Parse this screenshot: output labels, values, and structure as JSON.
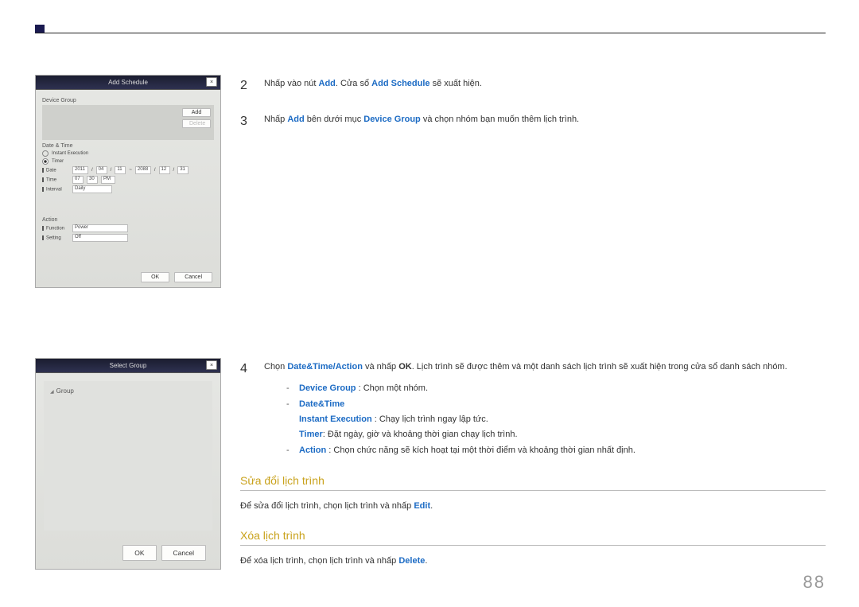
{
  "page_number": "88",
  "screenshots": {
    "add_schedule": {
      "title": "Add Schedule",
      "close": "×",
      "device_group_label": "Device Group",
      "add_btn": "Add",
      "delete_btn": "Delete",
      "datetime_label": "Date & Time",
      "instant_radio": "Instant Execution",
      "timer_radio": "Timer",
      "date_label": "Date",
      "date_y1": "2011",
      "date_m1": "04",
      "date_d1": "11",
      "date_tilde": "~",
      "date_y2": "2088",
      "date_m2": "12",
      "date_d2": "31",
      "time_label": "Time",
      "time_h": "07",
      "time_m": "30",
      "time_ampm": "PM",
      "interval_label": "Interval",
      "interval_val": "Daily",
      "action_label": "Action",
      "function_label": "Function",
      "function_val": "Power",
      "setting_label": "Setting",
      "setting_val": "Off",
      "ok": "OK",
      "cancel": "Cancel"
    },
    "select_group": {
      "title": "Select Group",
      "close": "×",
      "tree_root": "Group",
      "ok": "OK",
      "cancel": "Cancel"
    }
  },
  "steps": {
    "s2": {
      "num": "2",
      "t1": "Nhấp vào nút ",
      "k1": "Add",
      "t2": ". Cửa sổ ",
      "k2": "Add Schedule",
      "t3": " sẽ xuất hiện."
    },
    "s3": {
      "num": "3",
      "t1": "Nhấp ",
      "k1": "Add",
      "t2": " bên dưới mục ",
      "k2": "Device Group",
      "t3": " và chọn nhóm bạn muốn thêm lịch trình."
    },
    "s4": {
      "num": "4",
      "t1": "Chọn ",
      "k1": "Date&Time",
      "sep": "/",
      "k2": "Action",
      "t2": " và nhấp ",
      "k3": "OK",
      "t3": ". Lịch trình sẽ được thêm và một danh sách lịch trình sẽ xuất hiện trong cửa sổ danh sách nhóm.",
      "sub": {
        "i1": {
          "k": "Device Group",
          "t": " : Chọn một nhóm."
        },
        "i2": {
          "k": "Date&Time",
          "l1k": "Instant Execution",
          "l1t": " : Chạy lịch trình ngay lập tức.",
          "l2k": "Timer",
          "l2t": ": Đặt ngày, giờ và khoảng thời gian chạy lịch trình."
        },
        "i3": {
          "k": "Action",
          "t": " : Chọn chức năng sẽ kích hoạt tại một thời điểm và khoảng thời gian nhất định."
        }
      }
    }
  },
  "sections": {
    "modify": {
      "heading": "Sửa đổi lịch trình",
      "t1": "Để sửa đổi lịch trình, chọn lịch trình và nhấp ",
      "k": "Edit",
      "t2": "."
    },
    "delete": {
      "heading": "Xóa lịch trình",
      "t1": "Để xóa lịch trình, chọn lịch trình và nhấp ",
      "k": "Delete",
      "t2": "."
    }
  }
}
